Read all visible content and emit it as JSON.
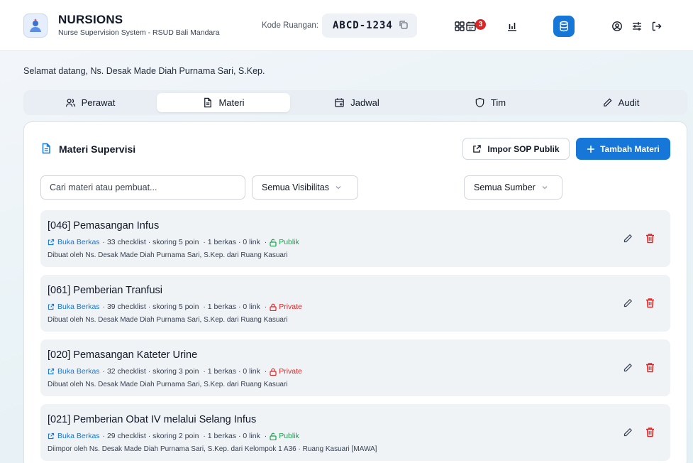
{
  "app": {
    "name": "NURSIONS",
    "subtitle": "Nurse Supervision System - RSUD Bali Mandara",
    "room_label": "Kode Ruangan:",
    "room_code": "ABCD-1234",
    "notification_count": "3"
  },
  "welcome": "Selamat datang, Ns. Desak Made Diah Purnama Sari, S.Kep.",
  "tabs": [
    {
      "label": "Perawat",
      "icon": "users-icon"
    },
    {
      "label": "Materi",
      "icon": "document-icon",
      "active": true
    },
    {
      "label": "Jadwal",
      "icon": "calendar-plus-icon"
    },
    {
      "label": "Tim",
      "icon": "shield-icon"
    },
    {
      "label": "Audit",
      "icon": "pencil-icon"
    }
  ],
  "panel": {
    "title": "Materi Supervisi",
    "import_label": "Impor SOP Publik",
    "add_label": "Tambah Materi",
    "search_placeholder": "Cari materi atau pembuat...",
    "visibility_filter": "Semua Visibilitas",
    "source_filter": "Semua Sumber"
  },
  "materials": [
    {
      "title": "[046] Pemasangan Infus",
      "open_label": "Buka Berkas",
      "details": "· 33 checklist · skoring 5 poin  · 1 berkas · 0 link  ·",
      "visibility": "Publik",
      "creator": "Dibuat oleh Ns. Desak Made Diah Purnama Sari, S.Kep. dari Ruang Kasuari"
    },
    {
      "title": "[061] Pemberian Tranfusi",
      "open_label": "Buka Berkas",
      "details": "· 39 checklist · skoring 5 poin  · 1 berkas · 0 link  ·",
      "visibility": "Private",
      "creator": "Dibuat oleh Ns. Desak Made Diah Purnama Sari, S.Kep. dari Ruang Kasuari"
    },
    {
      "title": "[020] Pemasangan Kateter Urine",
      "open_label": "Buka Berkas",
      "details": "· 32 checklist · skoring 3 poin  · 1 berkas · 0 link  ·",
      "visibility": "Private",
      "creator": "Dibuat oleh Ns. Desak Made Diah Purnama Sari, S.Kep. dari Ruang Kasuari"
    },
    {
      "title": "[021] Pemberian Obat IV melalui Selang Infus",
      "open_label": "Buka Berkas",
      "details": "· 29 checklist · skoring 2 poin  · 1 berkas · 0 link  ·",
      "visibility": "Publik",
      "creator": "Diimpor oleh Ns. Desak Made Diah Purnama Sari, S.Kep. dari Kelompok 1 A36 · Ruang Kasuari [MAWA]"
    }
  ],
  "colors": {
    "primary": "#1677d9",
    "public": "#16a34a",
    "private": "#dc2626"
  }
}
